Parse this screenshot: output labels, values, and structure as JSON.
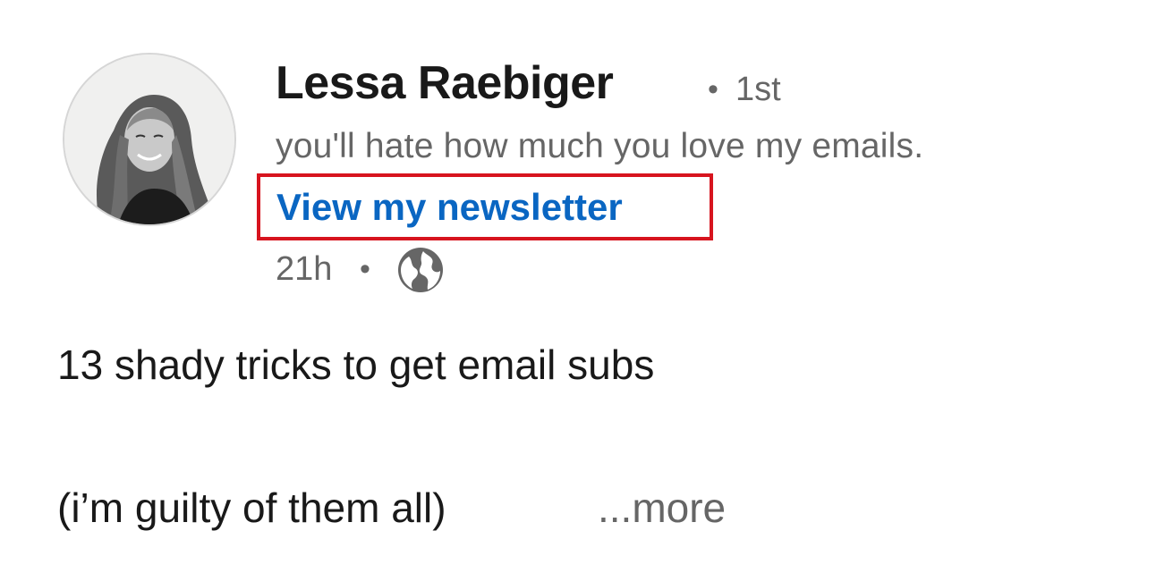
{
  "post": {
    "actor": {
      "name": "Lessa Raebiger",
      "separator": "•",
      "connection_degree": "1st",
      "headline": "you'll hate how much you love my emails.",
      "newsletter_link": "View my newsletter"
    },
    "meta": {
      "time_ago": "21h",
      "separator": "•",
      "visibility_icon": "globe-icon"
    },
    "text": {
      "line1": "13 shady tricks to get email subs",
      "line2": "(i’m guilty of them all)",
      "see_more": "...more"
    }
  },
  "colors": {
    "link": "#0a66c2",
    "highlight_border": "#d7141e",
    "secondary_text": "#666666",
    "primary_text": "#191919"
  }
}
